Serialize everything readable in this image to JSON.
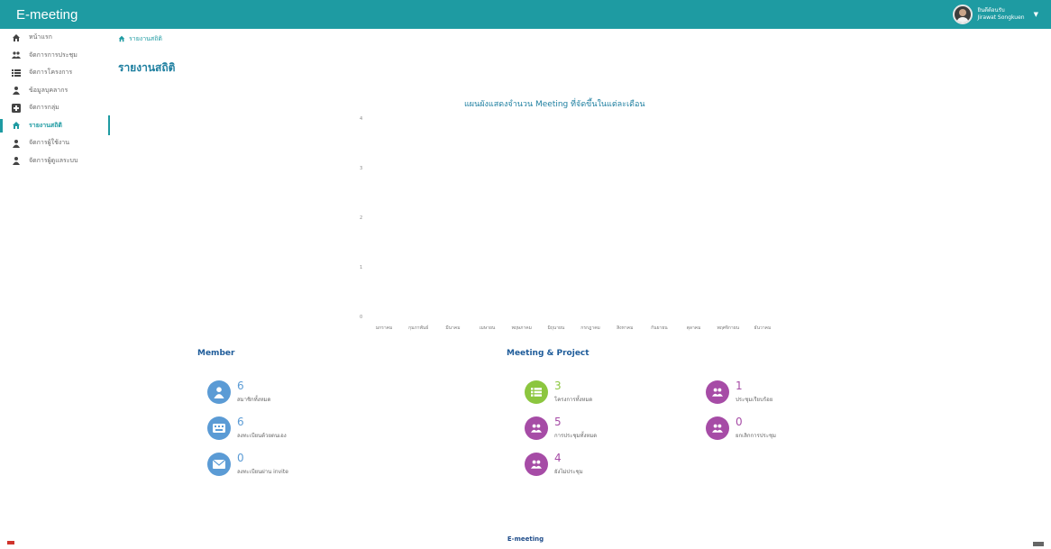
{
  "app": {
    "title": "E-meeting"
  },
  "user": {
    "greeting": "ยินดีต้อนรับ",
    "name": "Jirawat Songkuen"
  },
  "sidebar": {
    "items": [
      {
        "label": "หน้าแรก",
        "icon": "home-icon",
        "active": false
      },
      {
        "label": "จัดการการประชุม",
        "icon": "users-icon",
        "active": false
      },
      {
        "label": "จัดการโครงการ",
        "icon": "list-icon",
        "active": false
      },
      {
        "label": "ข้อมูลบุคลากร",
        "icon": "user-icon",
        "active": false
      },
      {
        "label": "จัดการกลุ่ม",
        "icon": "plus-square-icon",
        "active": false
      },
      {
        "label": "รายงานสถิติ",
        "icon": "home-icon",
        "active": true
      },
      {
        "label": "จัดการผู้ใช้งาน",
        "icon": "user-icon",
        "active": false
      },
      {
        "label": "จัดการผู้ดูแลระบบ",
        "icon": "user-icon",
        "active": false
      }
    ]
  },
  "breadcrumb": {
    "label": "รายงานสถิติ"
  },
  "page": {
    "title": "รายงานสถิติ"
  },
  "chart_data": {
    "type": "bar",
    "title": "แผนผังแสดงจำนวน Meeting ที่จัดขึ้นในแต่ละเดือน",
    "categories": [
      "มกราคม",
      "กุมภาพันธ์",
      "มีนาคม",
      "เมษายน",
      "พฤษภาคม",
      "มิถุนายน",
      "กรกฎาคม",
      "สิงหาคม",
      "กันยายน",
      "ตุลาคม",
      "พฤศจิกายน",
      "ธันวาคม"
    ],
    "values": [
      0,
      0,
      0,
      0,
      0,
      0,
      0,
      0,
      0,
      0,
      0,
      0
    ],
    "yticks": [
      "0",
      "1",
      "2",
      "3",
      "4"
    ],
    "ylim": [
      0,
      4
    ],
    "grid": false
  },
  "member": {
    "title": "Member",
    "stats": [
      {
        "value": "6",
        "label": "สมาชิกทั้งหมด",
        "icon": "user-icon",
        "color": "#5b9bd5"
      },
      {
        "value": "6",
        "label": "ลงทะเบียนด้วยตนเอง",
        "icon": "keyboard-icon",
        "color": "#5b9bd5"
      },
      {
        "value": "0",
        "label": "ลงทะเบียนผ่าน invite",
        "icon": "envelope-icon",
        "color": "#5b9bd5"
      }
    ]
  },
  "meeting": {
    "title": "Meeting & Project",
    "stats": [
      {
        "value": "3",
        "label": "โครงการทั้งหมด",
        "icon": "list-icon",
        "color": "#8cc63f"
      },
      {
        "value": "5",
        "label": "การประชุมทั้งหมด",
        "icon": "users-icon",
        "color": "#a64ca6"
      },
      {
        "value": "4",
        "label": "ยังไม่ประชุม",
        "icon": "users-icon",
        "color": "#a64ca6"
      },
      {
        "value": "1",
        "label": "ประชุมเรียบร้อย",
        "icon": "users-icon",
        "color": "#a64ca6"
      },
      {
        "value": "0",
        "label": "ยกเลิกการประชุม",
        "icon": "users-icon",
        "color": "#a64ca6"
      }
    ]
  },
  "footer": {
    "text": "E-meeting"
  }
}
